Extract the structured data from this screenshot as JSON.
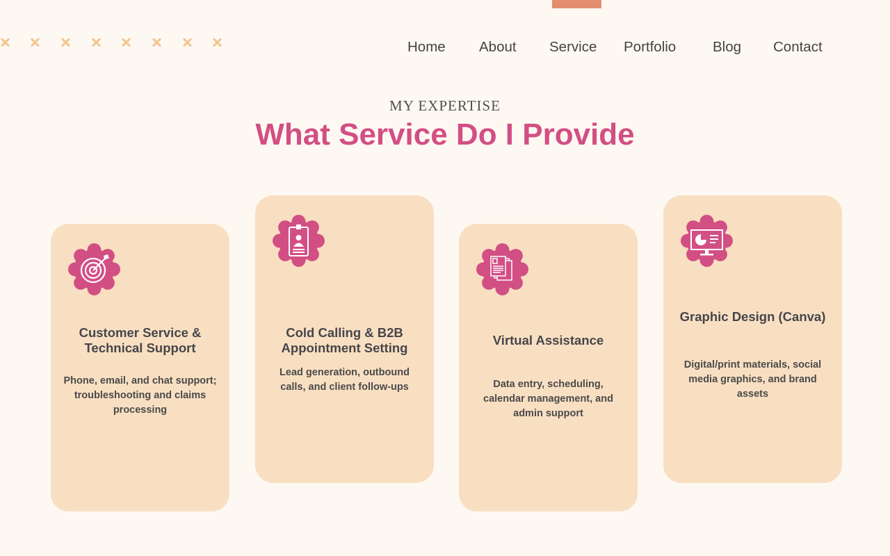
{
  "nav": {
    "items": [
      "Home",
      "About",
      "Service",
      "Portfolio",
      "Blog",
      "Contact"
    ]
  },
  "hero": {
    "subtitle": "MY EXPERTISE",
    "title": "What Service Do I Provide"
  },
  "colors": {
    "background": "#fef8f2",
    "accent_pink": "#d24f84",
    "card": "#f9dfc2",
    "decor_orange": "#e38e6e",
    "decor_marks": "#f4c490"
  },
  "cards": [
    {
      "icon": "target-icon",
      "title": "Customer Service & Technical Support",
      "description": "Phone, email, and chat support; troubleshooting and claims processing"
    },
    {
      "icon": "id-badge-icon",
      "title": "Cold Calling & B2B Appointment Setting",
      "description": "Lead generation, outbound calls, and client follow-ups"
    },
    {
      "icon": "documents-icon",
      "title": "Virtual Assistance",
      "description": "Data entry, scheduling, calendar management, and admin support"
    },
    {
      "icon": "monitor-chart-icon",
      "title": "Graphic Design (Canva)",
      "description": "Digital/print materials, social media graphics, and brand assets"
    }
  ]
}
